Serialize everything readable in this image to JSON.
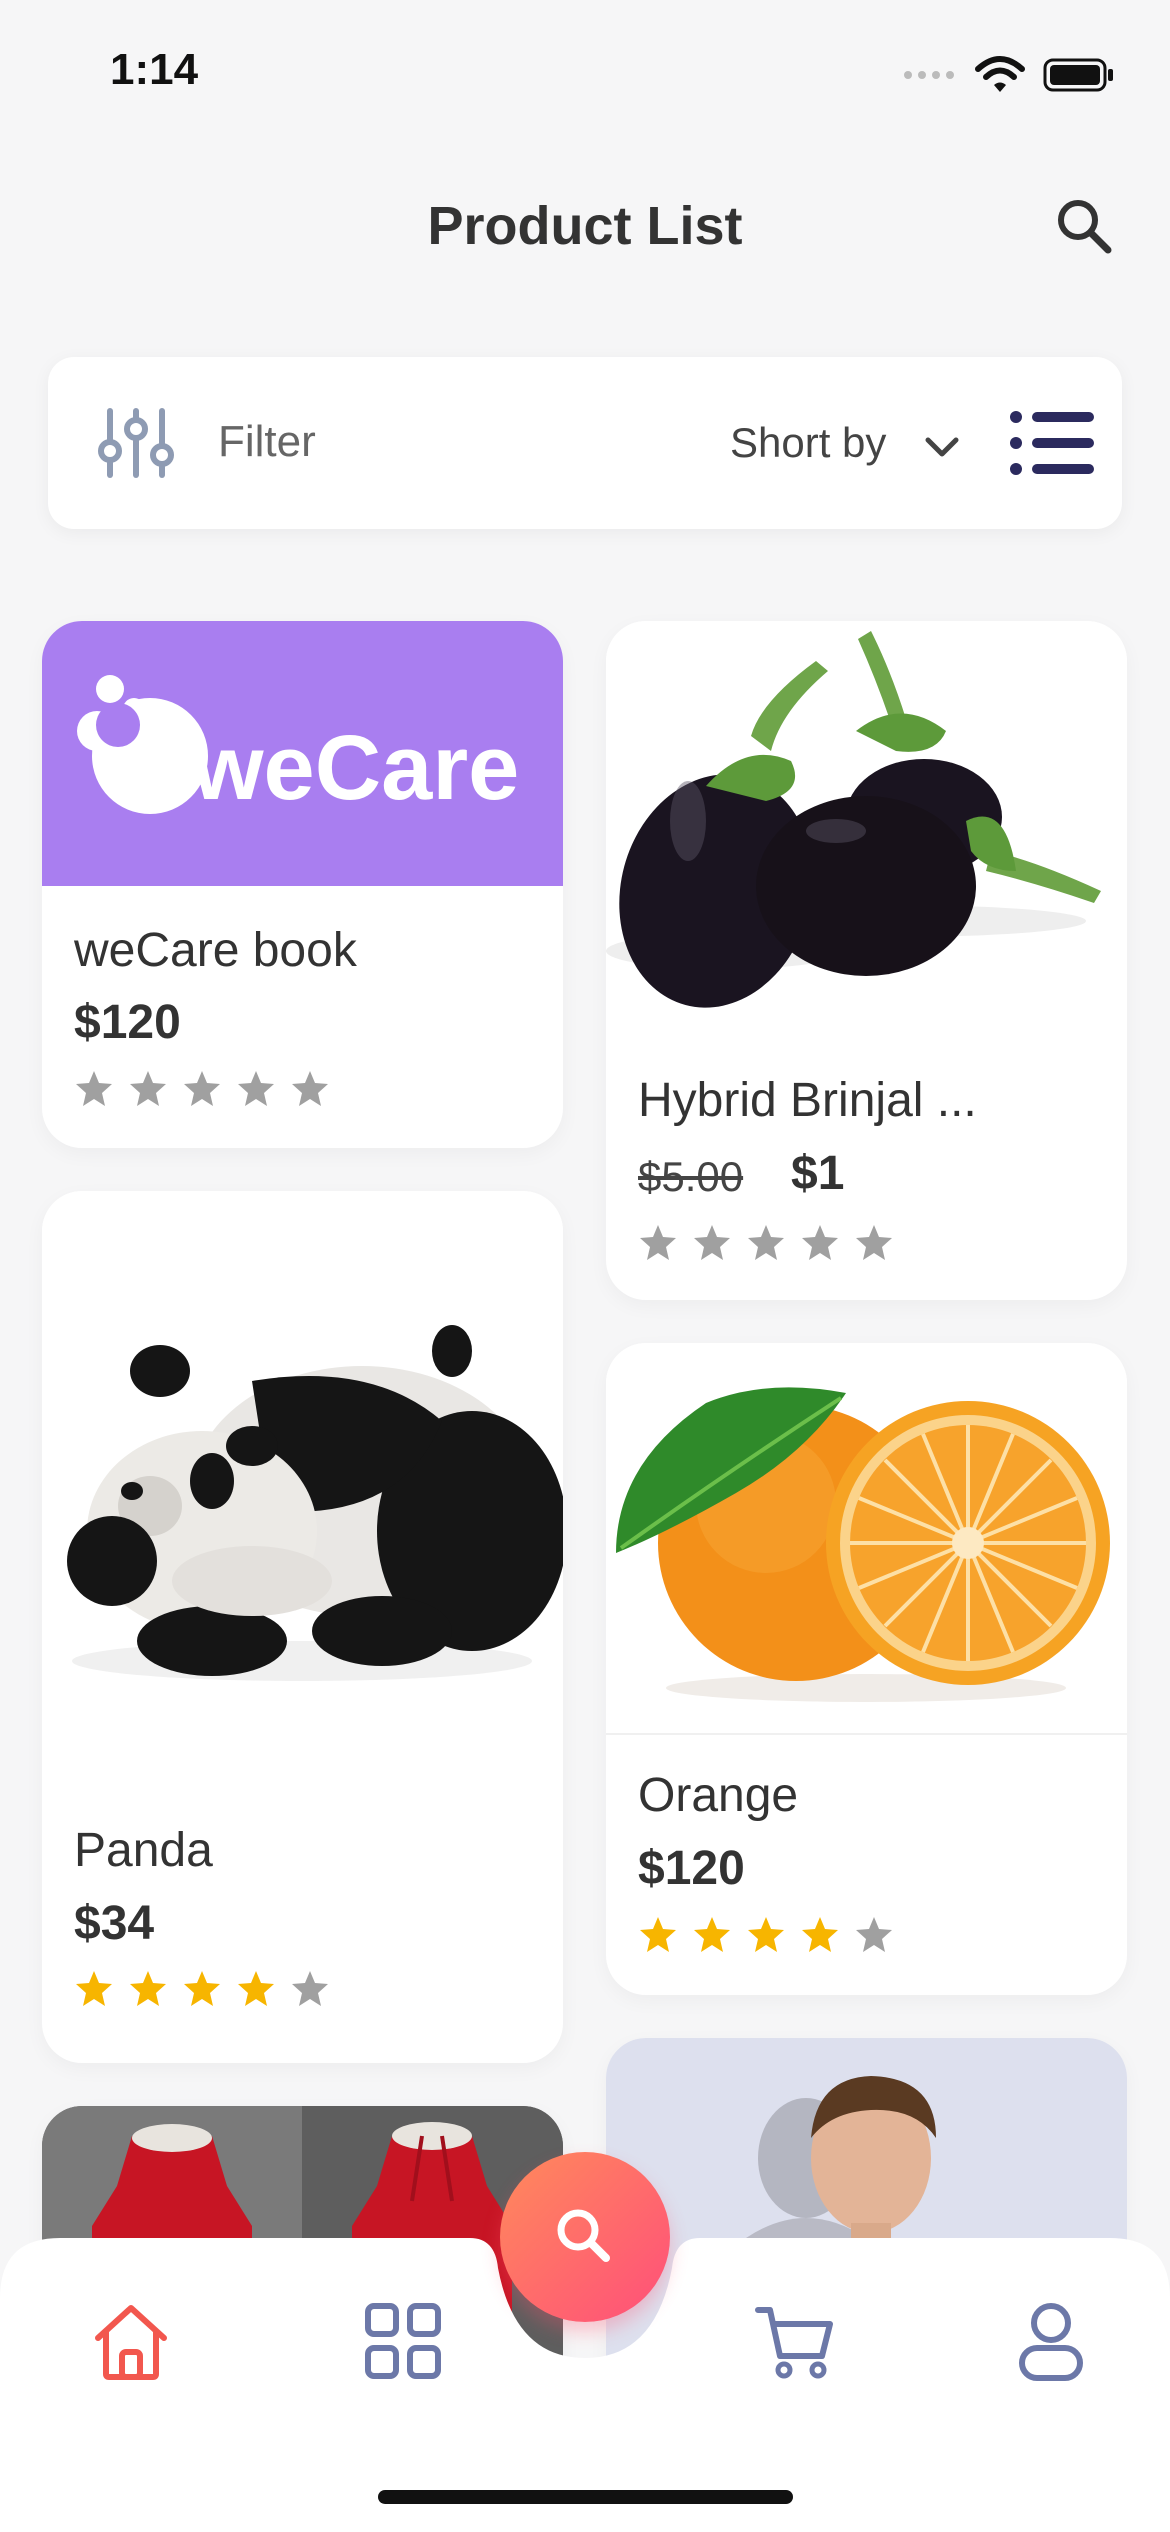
{
  "status_bar": {
    "time": "1:14"
  },
  "header": {
    "title": "Product List"
  },
  "filter_bar": {
    "filter_label": "Filter",
    "sort_label": "Short by"
  },
  "products": [
    {
      "name": "weCare book",
      "price": "$120",
      "rating": 0,
      "logo_text": "weCare"
    },
    {
      "name": "Hybrid Brinjal ...",
      "old_price": "$5.00",
      "price": "$1",
      "rating": 0
    },
    {
      "name": "Panda",
      "price": "$34",
      "rating": 4
    },
    {
      "name": "Orange",
      "price": "$120",
      "rating": 4
    },
    {
      "name": "",
      "price": "",
      "rating": 0
    },
    {
      "name": "",
      "price": "",
      "rating": 0
    }
  ],
  "nav": {
    "items": [
      "home-icon",
      "grid-icon",
      "search-icon",
      "cart-icon",
      "profile-icon"
    ],
    "active": "home-icon"
  },
  "colors": {
    "accent": "#f2574e",
    "fab_gradient_start": "#ff8a5b",
    "fab_gradient_end": "#ff4f7a",
    "nav_inactive": "#6c78a8",
    "star_on": "#f7b500",
    "star_off": "#a0a0a0",
    "list_icon": "#2b2a5e"
  }
}
